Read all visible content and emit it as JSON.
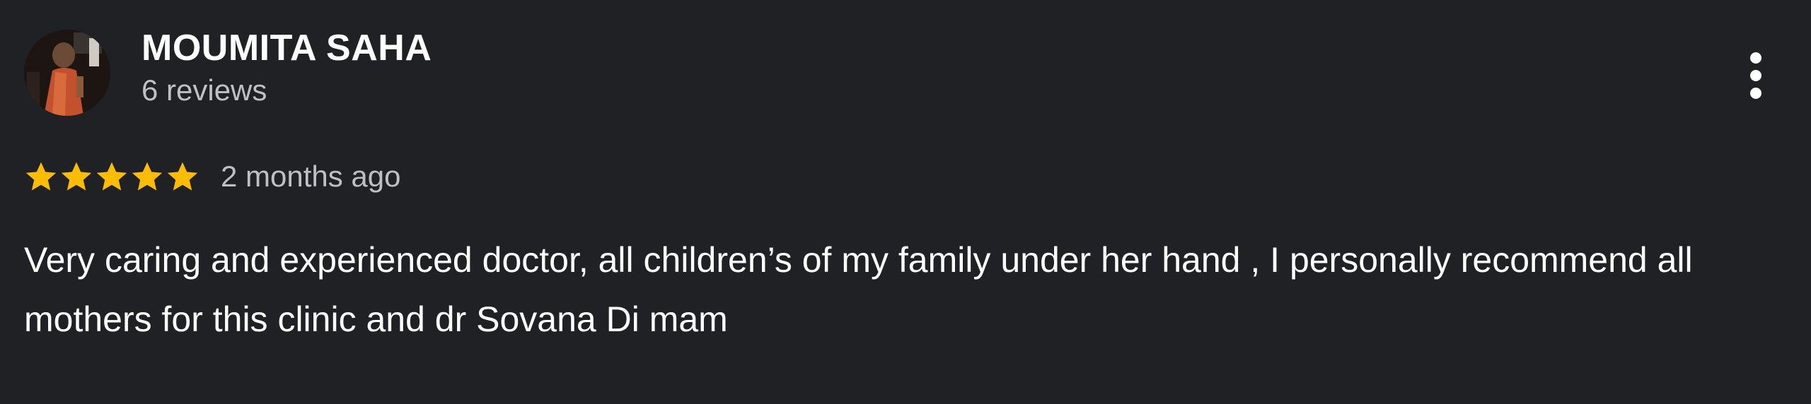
{
  "review": {
    "reviewer_name": "MOUMITA SAHA",
    "reviewer_reviews": "6 reviews",
    "avatar_icon": "profile-photo",
    "more_icon": "more-vertical-icon",
    "rating": 5,
    "rating_max": 5,
    "star_icon": "star-icon",
    "star_color": "#fbbc04",
    "time_ago": "2 months ago",
    "text": "Very caring and experienced doctor, all children’s of my family under her hand , I personally recommend all mothers for this clinic and dr Sovana Di mam"
  },
  "colors": {
    "background": "#202124",
    "primary_text": "#ffffff",
    "secondary_text": "#bdc1c6"
  }
}
